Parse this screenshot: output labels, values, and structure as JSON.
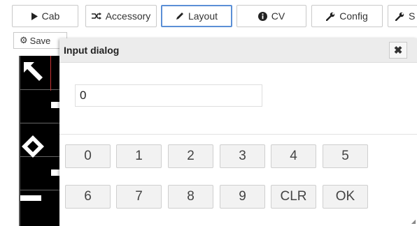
{
  "tabs": [
    {
      "label": "Cab",
      "icon": "play-icon",
      "active": false
    },
    {
      "label": "Accessory",
      "icon": "shuffle-icon",
      "active": false
    },
    {
      "label": "Layout",
      "icon": "pencil-icon",
      "active": true
    },
    {
      "label": "CV",
      "icon": "info-circle-icon",
      "active": false
    },
    {
      "label": "Config",
      "icon": "wrench-icon",
      "active": false
    },
    {
      "label": "S",
      "icon": "wrench-icon",
      "active": false
    }
  ],
  "save_button": {
    "label": "Save",
    "icon": "gear-icon"
  },
  "dialog": {
    "title": "Input dialog",
    "close_symbol": "✖",
    "input_value": "0",
    "keypad_row1": [
      "0",
      "1",
      "2",
      "3",
      "4",
      "5"
    ],
    "keypad_row2": [
      "6",
      "7",
      "8",
      "9",
      "CLR",
      "OK"
    ]
  },
  "colors": {
    "active_tab_border": "#5b8fd6",
    "canvas_bg": "#000000"
  }
}
